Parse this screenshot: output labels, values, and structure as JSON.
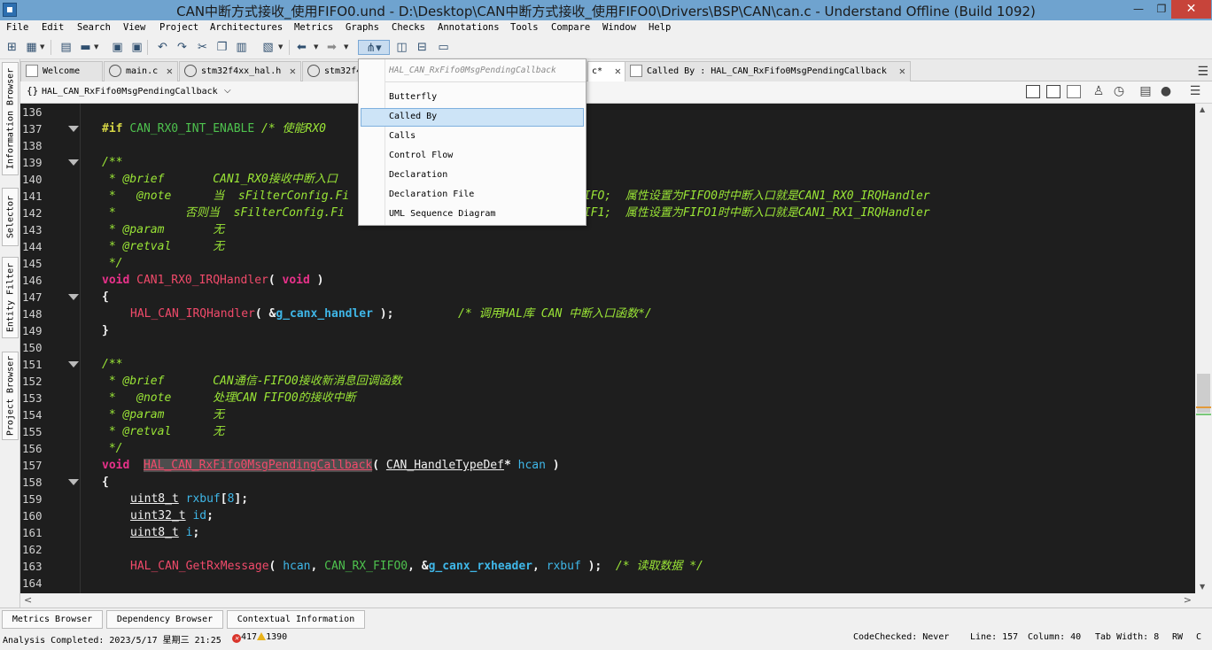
{
  "window": {
    "title": "CAN中断方式接收_使用FIFO0.und - D:\\Desktop\\CAN中断方式接收_使用FIFO0\\Drivers\\BSP\\CAN\\can.c - Understand Offline (Build 1092)",
    "minimize": "—",
    "restore": "❐",
    "close": "✕"
  },
  "menu": [
    "File",
    "Edit",
    "Search",
    "View",
    "Project",
    "Architectures",
    "Metrics",
    "Graphs",
    "Checks",
    "Annotations",
    "Tools",
    "Compare",
    "Window",
    "Help"
  ],
  "left_dock": [
    "Information Browser",
    "Selector",
    "Entity Filter",
    "Project Browser"
  ],
  "tabs": [
    {
      "label": "Welcome"
    },
    {
      "label": "main.c"
    },
    {
      "label": "stm32f4xx_hal.h"
    },
    {
      "label": "stm32f4"
    },
    {
      "label": "c*"
    },
    {
      "label": "Called By : HAL_CAN_RxFifo0MsgPendingCallback"
    }
  ],
  "scope": {
    "braces": "{}",
    "label": "HAL_CAN_RxFifo0MsgPendingCallback"
  },
  "graph_menu": {
    "header": "HAL_CAN_RxFifo0MsgPendingCallback",
    "items": [
      "Butterfly",
      "Called By",
      "Calls",
      "Control Flow",
      "Declaration",
      "Declaration File",
      "UML Sequence Diagram"
    ],
    "selected": "Called By"
  },
  "line_numbers": [
    "136",
    "137",
    "138",
    "139",
    "140",
    "141",
    "142",
    "143",
    "144",
    "145",
    "146",
    "147",
    "148",
    "149",
    "150",
    "151",
    "152",
    "153",
    "154",
    "155",
    "156",
    "157",
    "158",
    "159",
    "160",
    "161",
    "162",
    "163",
    "164"
  ],
  "code": {
    "l137": {
      "pp": "#if",
      "macro": "CAN_RX0_INT_ENABLE",
      "comment": "/* 使能RX0"
    },
    "l139": "/**",
    "l140": {
      "a": " * @brief       CAN1_RX0接收中断入口"
    },
    "l141": {
      "a": " *   @note      当  sFilterConfig.Fi",
      "b": "FIFO;  属性设置为FIFO0时中断入口就是CAN1_RX0_IRQHandler"
    },
    "l142": {
      "a": " *          否则当  sFilterConfig.Fi",
      "b": "FIF1;  属性设置为FIFO1时中断入口就是CAN1_RX1_IRQHandler"
    },
    "l143": " * @param       无",
    "l144": " * @retval      无",
    "l145": " */",
    "l146": {
      "kw": "void",
      "fn": "CAN1_RX0_IRQHandler",
      "open": "( ",
      "arg": "void",
      "close": " )"
    },
    "l147": "{",
    "l148": {
      "fn": "HAL_CAN_IRQHandler",
      "open": "( ",
      "amp": "&",
      "var": "g_canx_handler",
      "close": " );",
      "comment": "/* 调用HAL库 CAN 中断入口函数*/"
    },
    "l149": "}",
    "l151": "/**",
    "l152": " * @brief       CAN通信-FIFO0接收新消息回调函数",
    "l153": " *   @note      处理CAN FIFO0的接收中断",
    "l154": " * @param       无",
    "l155": " * @retval      无",
    "l156": " */",
    "l157": {
      "kw": "void",
      "fn": "HAL_CAN_RxFifo0MsgPendingCallback",
      "open": "( ",
      "type": "CAN_HandleTypeDef",
      "ptr": "* ",
      "var": "hcan",
      "close": " )"
    },
    "l158": "{",
    "l159": {
      "type": "uint8_t",
      "var": "rxbuf",
      "lb": "[",
      "num": "8",
      "rb": "];"
    },
    "l160": {
      "type": "uint32_t",
      "var": "id",
      "end": ";"
    },
    "l161": {
      "type": "uint8_t",
      "var": "i",
      "end": ";"
    },
    "l163": {
      "fn": "HAL_CAN_GetRxMessage",
      "open": "( ",
      "v1": "hcan",
      "c1": ", ",
      "macro": "CAN_RX_FIFO0",
      "c2": ", ",
      "amp": "&",
      "v2": "g_canx_rxheader",
      "c3": ", ",
      "v3": "rxbuf",
      "close": " );",
      "comment": "/* 读取数据 */"
    }
  },
  "bottom_tabs": [
    "Metrics Browser",
    "Dependency Browser",
    "Contextual Information"
  ],
  "status": {
    "analysis": "Analysis Completed: 2023/5/17 星期三 21:25",
    "errors": "417",
    "warnings": "1390",
    "codechecked": "CodeChecked: Never",
    "line": "Line: 157",
    "column": "Column: 40",
    "tabwidth": "Tab Width: 8",
    "mode": "RW",
    "extra": "C"
  },
  "colors": {
    "editor_bg": "#1e1e1e",
    "keyword": "#e8318a",
    "comment": "#9ae536",
    "function": "#f04a6a",
    "variable": "#3fb7e8",
    "macro": "#4ec24e",
    "preproc": "#d6d645"
  }
}
